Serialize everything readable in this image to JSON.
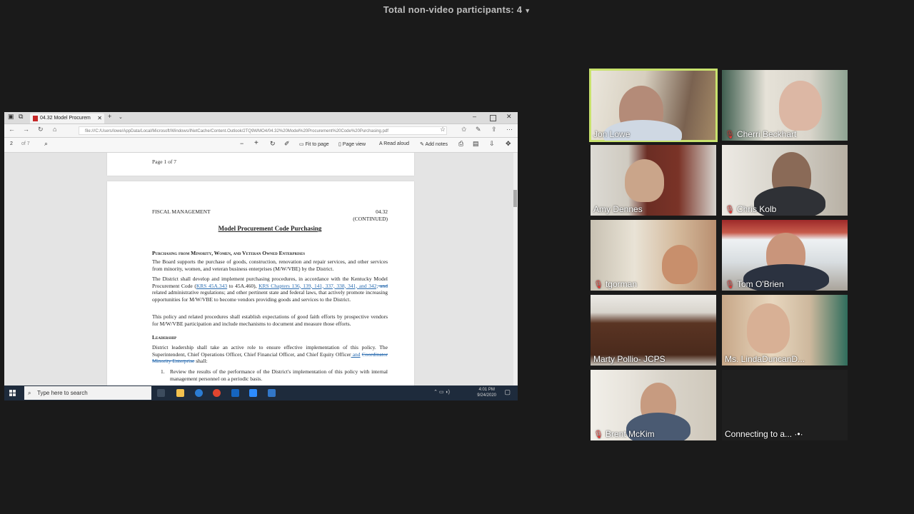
{
  "top_bar": {
    "label": "Total non-video participants: 4"
  },
  "browser": {
    "tab_title": "04.32 Model Procurem",
    "url": "file:///C:/Users/lowe/AppData/Local/Microsoft/Windows/INetCache/Content.Outlook/2TQ9WMO4/04.32%20Model%20Procurement%20Code%20Purchasing.pdf",
    "page_input": "2",
    "page_total": "of 7",
    "tools": {
      "fit": "Fit to page",
      "page_view": "Page view",
      "read_aloud": "Read aloud",
      "add_notes": "Add notes"
    }
  },
  "document": {
    "page1_label": "Page 1 of 7",
    "header_left": "FISCAL MANAGEMENT",
    "header_right": "04.32",
    "continued": "(CONTINUED)",
    "title": "Model Procurement Code Purchasing",
    "section1": "Purchasing from Minority, Women, and Veteran Owned Enterprises",
    "para1": "The Board supports the purchase of goods, construction, renovation and repair services, and other services from minority, women, and veteran business enterprises (M/W/VBE) by the District.",
    "para2_a": "The District shall develop and implement purchasing procedures, in accordance with the Kentucky Model Procurement Code (",
    "para2_link1": "KRS 45A.343",
    "para2_b": " to 45A.460), ",
    "para2_link2": "KRS Chapters 136, 139, 141, 337, 338, 341, and 342;",
    "para2_strike": " and",
    "para2_c": " related administrative regulations; and other pertinent state and federal laws, that actively promote increasing opportunities for M/W/VBE to become vendors providing goods and services to the District.",
    "para3": "This policy and related procedures shall establish expectations of good faith efforts by prospective vendors for M/W/VBE participation and include mechanisms to document and measure those efforts.",
    "section2": "Leadership",
    "para4_a": "District leadership shall take an active role to ensure effective implementation of this policy. The Superintendent, Chief Operations Officer, Chief Financial Officer, and Chief Equity Officer",
    "para4_link": " and",
    "para4_strike": "Coordinator Minority Enterprise",
    "para4_b": " shall:",
    "item1_num": "1.",
    "item1": "Review the results of the performance of the District's implementation of this policy with internal management personnel on a periodic basis."
  },
  "taskbar": {
    "search_placeholder": "Type here to search",
    "time": "4:01 PM",
    "date": "9/24/2020"
  },
  "participants": [
    {
      "name": "Jon Lowe",
      "muted": false,
      "active": true
    },
    {
      "name": "Cherri Beckhart",
      "muted": true,
      "active": false
    },
    {
      "name": "Amy Dennes",
      "muted": false,
      "active": false
    },
    {
      "name": "Chris Kolb",
      "muted": true,
      "active": false
    },
    {
      "name": "tgorman",
      "muted": true,
      "active": false
    },
    {
      "name": "Tom O'Brien",
      "muted": true,
      "active": false
    },
    {
      "name": "Marty Pollio- JCPS",
      "muted": false,
      "active": false
    },
    {
      "name": "Ms. LindaDuncanD...",
      "muted": false,
      "active": false
    },
    {
      "name": "Brent McKim",
      "muted": true,
      "active": false
    },
    {
      "name": "Connecting to a...",
      "muted": false,
      "active": false
    }
  ],
  "colors": {
    "active_speaker": "#c8e26d",
    "mute": "#e53935",
    "background": "#1a1a1a"
  }
}
